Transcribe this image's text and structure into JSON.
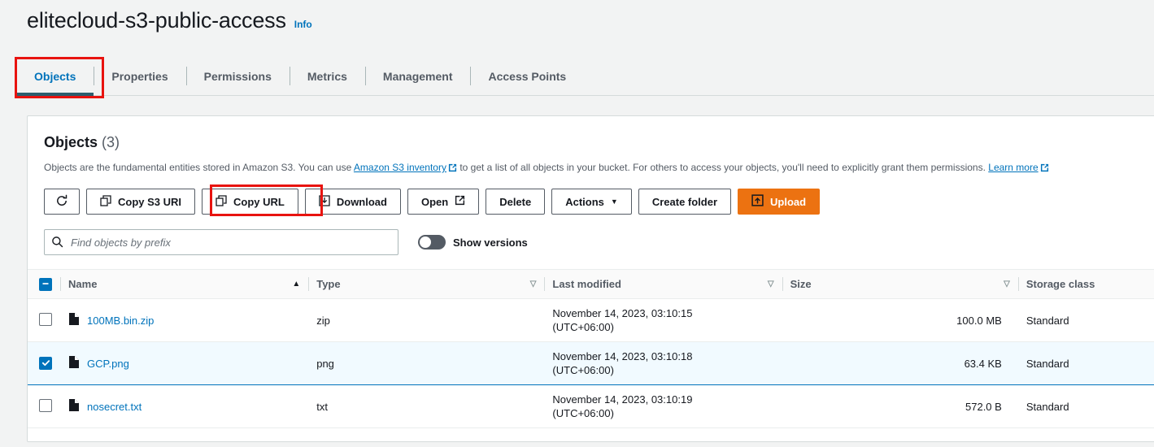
{
  "header": {
    "bucket_name": "elitecloud-s3-public-access",
    "info_label": "Info"
  },
  "tabs": [
    {
      "label": "Objects",
      "active": true
    },
    {
      "label": "Properties",
      "active": false
    },
    {
      "label": "Permissions",
      "active": false
    },
    {
      "label": "Metrics",
      "active": false
    },
    {
      "label": "Management",
      "active": false
    },
    {
      "label": "Access Points",
      "active": false
    }
  ],
  "panel": {
    "title": "Objects",
    "count": "(3)",
    "description_part1": "Objects are the fundamental entities stored in Amazon S3. You can use",
    "inventory_link": "Amazon S3 inventory",
    "description_part2": "to get a list of all objects in your bucket. For others to access your objects, you'll need to explicitly grant them permissions.",
    "learn_more_link": "Learn more"
  },
  "toolbar": {
    "refresh_icon": "refresh-icon",
    "copy_s3_uri": "Copy S3 URI",
    "copy_url": "Copy URL",
    "download": "Download",
    "open": "Open",
    "delete": "Delete",
    "actions": "Actions",
    "actions_caret": "▼",
    "create_folder": "Create folder",
    "upload": "Upload"
  },
  "search": {
    "placeholder": "Find objects by prefix",
    "value": "",
    "show_versions_label": "Show versions",
    "show_versions_on": false
  },
  "table": {
    "select_all_state": "indeterminate",
    "columns": [
      {
        "label": "Name",
        "sort": "asc",
        "sort_glyph": "▲"
      },
      {
        "label": "Type",
        "sort": "none",
        "sort_glyph": "▽"
      },
      {
        "label": "Last modified",
        "sort": "none",
        "sort_glyph": "▽"
      },
      {
        "label": "Size",
        "sort": "none",
        "sort_glyph": "▽"
      },
      {
        "label": "Storage class",
        "sort": "none",
        "sort_glyph": ""
      }
    ],
    "rows": [
      {
        "selected": false,
        "name": "100MB.bin.zip",
        "type": "zip",
        "modified_date": "November 14, 2023, 03:10:15",
        "modified_tz": "(UTC+06:00)",
        "size": "100.0 MB",
        "storage_class": "Standard"
      },
      {
        "selected": true,
        "name": "GCP.png",
        "type": "png",
        "modified_date": "November 14, 2023, 03:10:18",
        "modified_tz": "(UTC+06:00)",
        "size": "63.4 KB",
        "storage_class": "Standard"
      },
      {
        "selected": false,
        "name": "nosecret.txt",
        "type": "txt",
        "modified_date": "November 14, 2023, 03:10:19",
        "modified_tz": "(UTC+06:00)",
        "size": "572.0 B",
        "storage_class": "Standard"
      }
    ]
  },
  "annotations": [
    {
      "name": "objects-tab-highlight",
      "color": "#e8130f"
    },
    {
      "name": "copy-url-highlight",
      "color": "#e8130f"
    }
  ],
  "colors": {
    "link": "#0073bb",
    "upload_orange": "#ec7211",
    "annotation_red": "#e8130f",
    "selected_row_bg": "#f1faff"
  }
}
